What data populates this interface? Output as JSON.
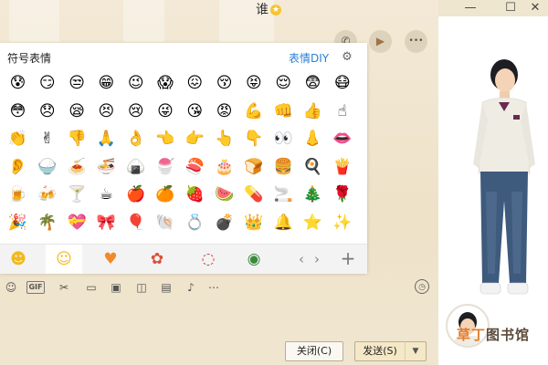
{
  "window": {
    "title": "谁",
    "title_icon": "star-badge-icon",
    "min_label": "—",
    "max_label": "☐",
    "close_label": "✕"
  },
  "header": {
    "phone": "✆",
    "video": "▶",
    "more": "•••"
  },
  "emoji_panel": {
    "title": "符号表情",
    "diy_label": "表情DIY",
    "settings_icon": "⚙",
    "rows": [
      [
        "😰",
        "😏",
        "😒",
        "😁",
        "😉",
        "😱",
        "😖",
        "😚",
        "😝",
        "😌",
        "😨",
        "😷"
      ],
      [
        "😳",
        "😞",
        "😪",
        "😣",
        "😢",
        "😜",
        "😘",
        "😡",
        "💪",
        "👊",
        "👍",
        "☝"
      ],
      [
        "👏",
        "✌",
        "👎",
        "🙏",
        "👌",
        "👈",
        "👉",
        "👆",
        "👇",
        "👀",
        "👃",
        "👄"
      ],
      [
        "👂",
        "🍚",
        "🍝",
        "🍜",
        "🍙",
        "🍧",
        "🍣",
        "🎂",
        "🍞",
        "🍔",
        "🍳",
        "🍟"
      ],
      [
        "🍺",
        "🍻",
        "🍸",
        "☕",
        "🍎",
        "🍊",
        "🍓",
        "🍉",
        "💊",
        "🚬",
        "🎄",
        "🌹"
      ],
      [
        "🎉",
        "🌴",
        "💝",
        "🎀",
        "🎈",
        "🐚",
        "💍",
        "💣",
        "👑",
        "🔔",
        "⭐",
        "✨"
      ]
    ],
    "tabs": [
      {
        "icon": "☻",
        "name": "emoji-tab-icon"
      },
      {
        "icon": "☺",
        "name": "symbol-tab-icon"
      },
      {
        "icon": "♥",
        "name": "favorites-tab-icon"
      },
      {
        "icon": "✿",
        "name": "qq-character-tab-icon"
      },
      {
        "icon": "◌",
        "name": "sticker-tab-icon"
      },
      {
        "icon": "◉",
        "name": "green-character-tab-icon"
      }
    ],
    "prev_label": "‹",
    "next_label": "›",
    "add_label": "+"
  },
  "toolbar": {
    "tools": [
      {
        "name": "face-icon",
        "glyph": "☺"
      },
      {
        "name": "gif-icon",
        "glyph": "GIF"
      },
      {
        "name": "scissors-icon",
        "glyph": "✂"
      },
      {
        "name": "folder-icon",
        "glyph": "▭"
      },
      {
        "name": "image-icon",
        "glyph": "▣"
      },
      {
        "name": "shake-icon",
        "glyph": "◫"
      },
      {
        "name": "red-envelope-icon",
        "glyph": "▤"
      },
      {
        "name": "music-icon",
        "glyph": "♪"
      },
      {
        "name": "more-tools-icon",
        "glyph": "⋯"
      }
    ],
    "history_icon": "◷"
  },
  "buttons": {
    "close": "关闭(C)",
    "send": "发送(S)",
    "send_dropdown": "▼"
  },
  "watermark": {
    "part1": "草丁",
    "part2": "图书馆"
  },
  "colors": {
    "accent_blue": "#2a7fd4",
    "heart": "#f08a2a",
    "panel_bg": "#ffffff",
    "chrome_bg": "#efe6cf"
  }
}
